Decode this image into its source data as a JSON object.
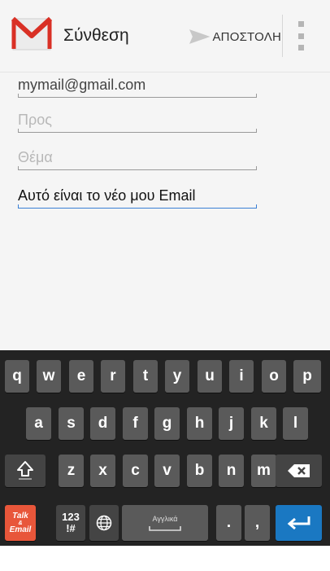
{
  "action_bar": {
    "title": "Σύνθεση",
    "send_label": "ΑΠΟΣΤΟΛΗ",
    "icons": {
      "app": "gmail-icon",
      "send": "send-icon",
      "overflow": "overflow-menu-icon"
    },
    "colors": {
      "gmail_red": "#d93025",
      "focus_blue": "#3a7fd5"
    }
  },
  "compose": {
    "from_value": "mymail@gmail.com",
    "to_placeholder": "Προς",
    "subject_placeholder": "Θέμα",
    "body_value": "Αυτό είναι το νέο μου Email"
  },
  "keyboard": {
    "row1": [
      "q",
      "w",
      "e",
      "r",
      "t",
      "y",
      "u",
      "i",
      "o",
      "p"
    ],
    "row2": [
      "a",
      "s",
      "d",
      "f",
      "g",
      "h",
      "j",
      "k",
      "l"
    ],
    "row3": [
      "z",
      "x",
      "c",
      "v",
      "b",
      "n",
      "m"
    ],
    "talk_line1": "Talk",
    "talk_line2": "&",
    "talk_line3": "Email",
    "symbols_line1": "123",
    "symbols_line2": "!#",
    "space_label": "Αγγλικά",
    "period": ".",
    "comma": ",",
    "icons": {
      "shift": "shift-icon",
      "backspace": "backspace-icon",
      "globe": "globe-icon",
      "enter": "enter-icon"
    }
  }
}
